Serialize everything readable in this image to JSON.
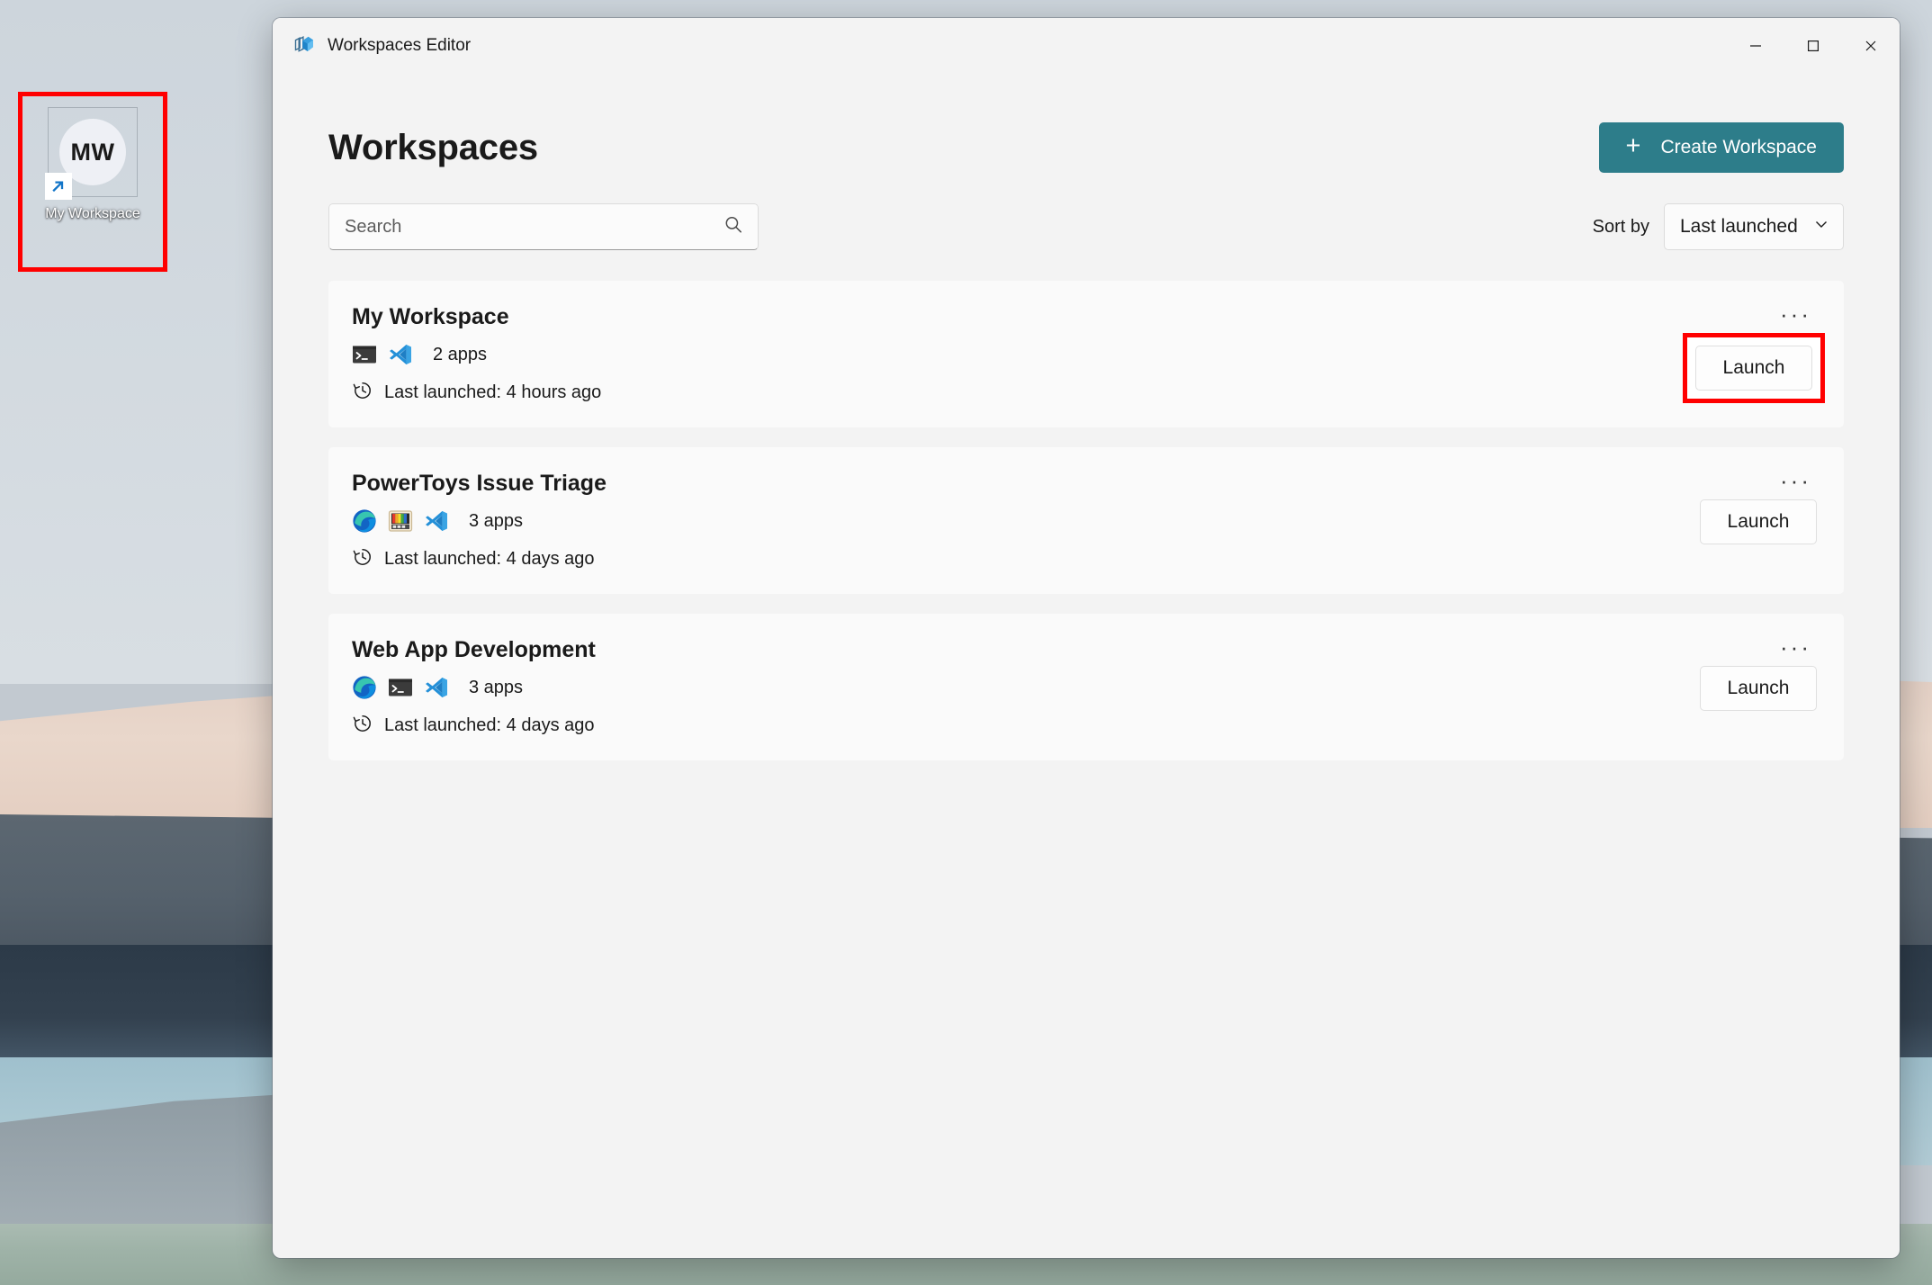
{
  "desktop": {
    "shortcut": {
      "initials": "MW",
      "label": "My Workspace",
      "badge_icon": "shortcut-arrow-icon"
    },
    "wallpaper_colors": {
      "sky": "#d3dae0",
      "dune": "#e6d3c7",
      "dune_shadow": "#55616c",
      "water_dark": "#2c3a48",
      "water_light": "#a9c7d2",
      "hill": "#9aa6ad",
      "grass": "#9fb3a8"
    }
  },
  "window": {
    "title": "Workspaces Editor",
    "app_icon": "workspaces-cube-icon",
    "controls": {
      "minimize": "minimize-icon",
      "maximize": "maximize-icon",
      "close": "close-icon"
    }
  },
  "header": {
    "title": "Workspaces",
    "create_button": {
      "label": "Create Workspace",
      "plus": "+",
      "accent_color": "#2d7d8a"
    }
  },
  "toolbar": {
    "search": {
      "placeholder": "Search",
      "value": "",
      "icon": "search-icon"
    },
    "sort": {
      "label": "Sort by",
      "selected": "Last launched",
      "chevron": "chevron-down-icon"
    }
  },
  "workspaces": [
    {
      "name": "My Workspace",
      "apps_label": "2 apps",
      "app_icons": [
        "terminal-icon",
        "vscode-icon"
      ],
      "last_launched": "Last launched: 4 hours ago",
      "clock_icon": "history-clock-icon",
      "launch_label": "Launch",
      "more_label": "···",
      "highlighted": true
    },
    {
      "name": "PowerToys Issue Triage",
      "apps_label": "3 apps",
      "app_icons": [
        "edge-icon",
        "colorpicker-icon",
        "vscode-icon"
      ],
      "last_launched": "Last launched: 4 days ago",
      "clock_icon": "history-clock-icon",
      "launch_label": "Launch",
      "more_label": "···",
      "highlighted": false
    },
    {
      "name": "Web App Development",
      "apps_label": "3 apps",
      "app_icons": [
        "edge-icon",
        "terminal-icon",
        "vscode-icon"
      ],
      "last_launched": "Last launched: 4 days ago",
      "clock_icon": "history-clock-icon",
      "launch_label": "Launch",
      "more_label": "···",
      "highlighted": false
    }
  ],
  "annotations": {
    "highlight_color": "#ff0000",
    "boxes": [
      "desktop-shortcut",
      "launch-button-my-workspace"
    ]
  }
}
